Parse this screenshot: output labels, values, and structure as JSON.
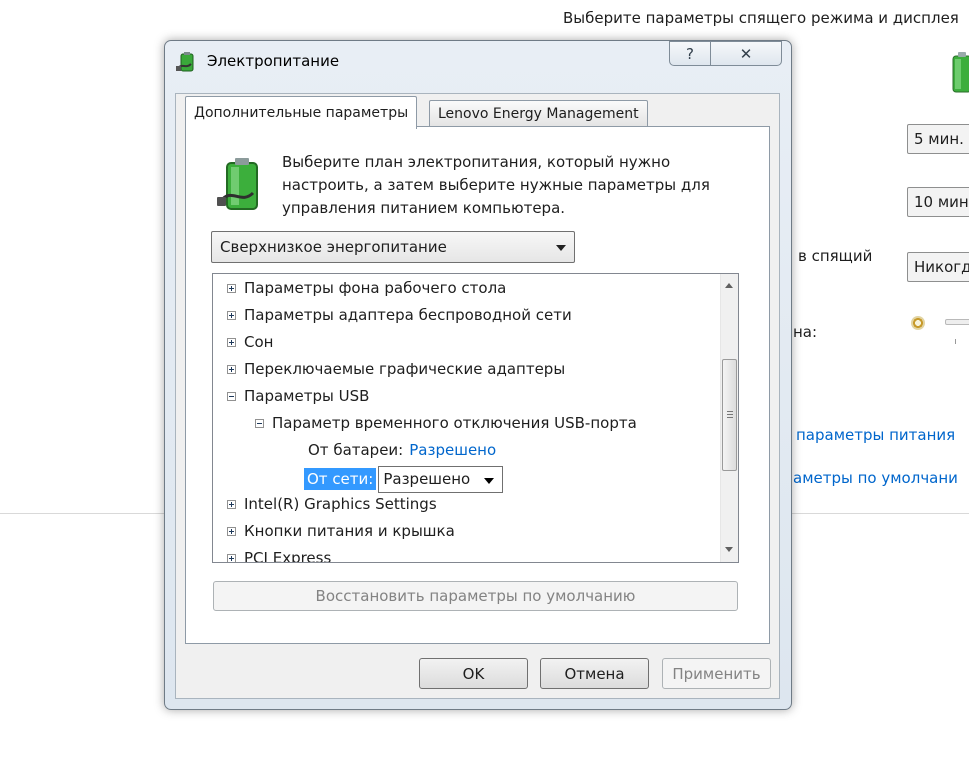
{
  "background": {
    "header": "Выберите параметры спящего режима и дисплея",
    "selects": [
      "5 мин.",
      "10 мин",
      "Никогд"
    ],
    "labels": [
      "в спящий",
      "на:"
    ],
    "links": [
      "параметры питания",
      "аметры по умолчани"
    ]
  },
  "dialog": {
    "title": "Электропитание",
    "help_glyph": "?",
    "close_glyph": "✕",
    "tabs": [
      {
        "label": "Дополнительные параметры",
        "active": true
      },
      {
        "label": "Lenovo Energy Management",
        "active": false
      }
    ],
    "description": "Выберите план электропитания, который нужно настроить, а затем выберите нужные параметры для управления питанием компьютера.",
    "plan_select": {
      "value": "Сверхнизкое энергопитание"
    },
    "tree": [
      {
        "label": "Параметры фона рабочего стола",
        "expander": "plus"
      },
      {
        "label": "Параметры адаптера беспроводной сети",
        "expander": "plus"
      },
      {
        "label": "Сон",
        "expander": "plus"
      },
      {
        "label": "Переключаемые графические адаптеры",
        "expander": "plus"
      },
      {
        "label": "Параметры USB",
        "expander": "minus"
      },
      {
        "label": "Параметр временного отключения USB-порта",
        "expander": "minus"
      },
      {
        "label": "От батареи:",
        "value": "Разрешено"
      },
      {
        "label": "От сети:",
        "value": "Разрешено"
      },
      {
        "label": "Intel(R) Graphics Settings",
        "expander": "plus"
      },
      {
        "label": "Кнопки питания и крышка",
        "expander": "plus"
      },
      {
        "label": "PCI Express",
        "expander": "plus"
      }
    ],
    "restore_label": "Восстановить параметры по умолчанию",
    "buttons": {
      "ok": "OK",
      "cancel": "Отмена",
      "apply": "Применить"
    }
  },
  "colors": {
    "link": "#0066cc",
    "selection": "#3399ff",
    "disabled_text": "#838383"
  }
}
